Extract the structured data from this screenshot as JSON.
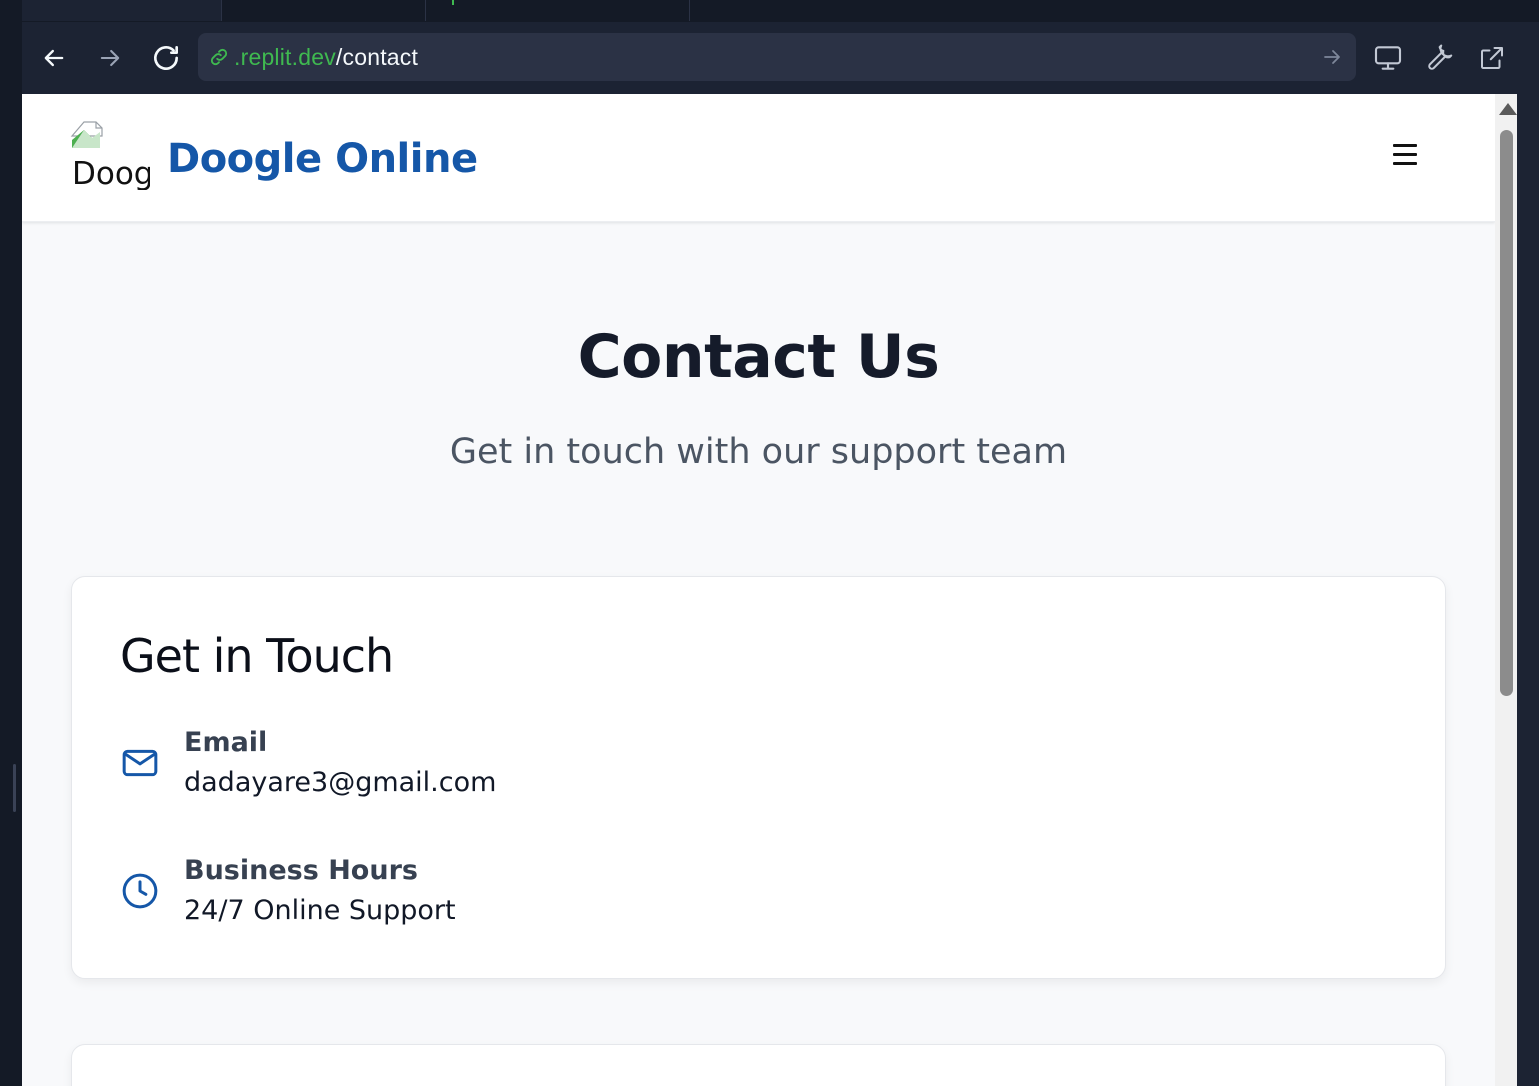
{
  "browser": {
    "url_host": ".replit.dev",
    "url_path": "/contact",
    "icons": [
      "arrow-left-icon",
      "arrow-right-icon",
      "reload-icon",
      "link-icon",
      "go-arrow-icon",
      "monitor-icon",
      "wrench-icon",
      "external-link-icon"
    ],
    "colors": {
      "chrome_bg": "#1c2333",
      "url_bg": "#2b3245",
      "host_green": "#3fb950"
    }
  },
  "header": {
    "logo_alt": "Doogle Online",
    "brand": "Doogle Online",
    "menu_icon": "hamburger-menu-icon",
    "brand_color": "#1557a8"
  },
  "hero": {
    "title": "Contact Us",
    "subtitle": "Get in touch with our support team"
  },
  "contact_card": {
    "title": "Get in Touch",
    "items": [
      {
        "icon": "mail-icon",
        "label": "Email",
        "value": "dadayare3@gmail.com"
      },
      {
        "icon": "clock-icon",
        "label": "Business Hours",
        "value": "24/7 Online Support"
      }
    ],
    "icon_color": "#1557a8"
  }
}
